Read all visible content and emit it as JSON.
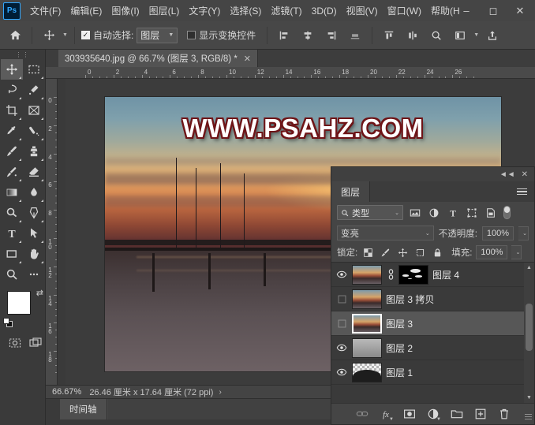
{
  "app": {
    "logo": "Ps",
    "menus": [
      {
        "label": "文件(F)"
      },
      {
        "label": "编辑(E)"
      },
      {
        "label": "图像(I)"
      },
      {
        "label": "图层(L)"
      },
      {
        "label": "文字(Y)"
      },
      {
        "label": "选择(S)"
      },
      {
        "label": "滤镜(T)"
      },
      {
        "label": "3D(D)"
      },
      {
        "label": "视图(V)"
      },
      {
        "label": "窗口(W)"
      },
      {
        "label": "帮助(H"
      }
    ],
    "window_controls": {
      "minimize": "–",
      "maximize": "◻",
      "close": "✕"
    }
  },
  "options_bar": {
    "home_icon": "home-icon",
    "tool_icon": "move-tool-icon",
    "auto_select_checked": true,
    "auto_select_label": "自动选择:",
    "auto_select_value": "图层",
    "show_transform_checked": false,
    "show_transform_label": "显示变换控件",
    "align_icons": [
      "align-left-icon",
      "align-center-horizontal-icon",
      "align-right-icon",
      "align-bottom-icon"
    ],
    "distribute_icons": [
      "distribute-top-icon",
      "distribute-vertical-center-icon"
    ],
    "search_icon": "search-icon",
    "workspace_icon": "workspace-icon",
    "share_icon": "share-icon"
  },
  "toolbar": {
    "grip": "⋮⋮",
    "tools": [
      {
        "name": "move-tool",
        "glyph": "✥",
        "active": true,
        "has_flyout": true
      },
      {
        "name": "marquee-tool",
        "glyph": "▭",
        "active": false,
        "has_flyout": true
      },
      {
        "name": "lasso-tool",
        "glyph": "◯",
        "active": false,
        "has_flyout": true
      },
      {
        "name": "quick-selection-tool",
        "glyph": "✎",
        "active": false,
        "has_flyout": true
      },
      {
        "name": "crop-tool",
        "glyph": "⌗",
        "active": false,
        "has_flyout": true
      },
      {
        "name": "frame-tool",
        "glyph": "⊠",
        "active": false,
        "has_flyout": true
      },
      {
        "name": "eyedropper-tool",
        "glyph": "✐",
        "active": false,
        "has_flyout": true
      },
      {
        "name": "healing-brush-tool",
        "glyph": "✦",
        "active": false,
        "has_flyout": true
      },
      {
        "name": "brush-tool",
        "glyph": "✏",
        "active": false,
        "has_flyout": true
      },
      {
        "name": "clone-stamp-tool",
        "glyph": "⎙",
        "active": false,
        "has_flyout": true
      },
      {
        "name": "history-brush-tool",
        "glyph": "✧",
        "active": false,
        "has_flyout": true
      },
      {
        "name": "eraser-tool",
        "glyph": "◣",
        "active": false,
        "has_flyout": true
      },
      {
        "name": "gradient-tool",
        "glyph": "▤",
        "active": false,
        "has_flyout": true
      },
      {
        "name": "blur-tool",
        "glyph": "◐",
        "active": false,
        "has_flyout": true
      },
      {
        "name": "dodge-tool",
        "glyph": "◔",
        "active": false,
        "has_flyout": true
      },
      {
        "name": "pen-tool",
        "glyph": "✒",
        "active": false,
        "has_flyout": true
      },
      {
        "name": "type-tool",
        "glyph": "T",
        "active": false,
        "has_flyout": true
      },
      {
        "name": "path-selection-tool",
        "glyph": "➤",
        "active": false,
        "has_flyout": true
      },
      {
        "name": "rectangle-tool",
        "glyph": "▭",
        "active": false,
        "has_flyout": true
      },
      {
        "name": "hand-tool",
        "glyph": "✋",
        "active": false,
        "has_flyout": true
      },
      {
        "name": "zoom-tool",
        "glyph": "⚲",
        "active": false,
        "has_flyout": false
      },
      {
        "name": "edit-toolbar-tool",
        "glyph": "•••",
        "active": false,
        "has_flyout": false
      }
    ],
    "foreground_color": "#ffffff",
    "background_color": "#8187a8",
    "swap_icon": "swap-colors-icon",
    "default_colors_icon": "default-colors-icon",
    "quick_mask_icon": "quick-mask-icon",
    "screen_mode_icon": "screen-mode-icon"
  },
  "document": {
    "tab_title": "303935640.jpg @ 66.7% (图层 3, RGB/8) *",
    "close_glyph": "✕",
    "watermark": "WWW.PSAHZ.COM",
    "ruler_h_ticks": [
      "0",
      "2",
      "4",
      "6",
      "8",
      "10",
      "12",
      "14",
      "16",
      "18",
      "20",
      "22",
      "24",
      "26"
    ],
    "ruler_v_ticks": [
      "0",
      "2",
      "4",
      "6",
      "8",
      "10",
      "12",
      "14",
      "16",
      "18"
    ]
  },
  "status_bar": {
    "zoom": "66.67%",
    "dimensions": "26.46 厘米 x 17.64 厘米 (72 ppi)",
    "arrow": "›"
  },
  "timeline": {
    "tab_label": "时间轴"
  },
  "layers_panel": {
    "collapse_icon": "collapse-panel-icon",
    "close_icon": "close-panel-icon",
    "tab_label": "图层",
    "menu_icon": "panel-menu-icon",
    "filter": {
      "search_icon": "search-icon",
      "type_label": "类型",
      "caret": "⌄",
      "icons": [
        {
          "name": "filter-pixel-icon",
          "glyph": "▣"
        },
        {
          "name": "filter-adjustment-icon",
          "glyph": "◑"
        },
        {
          "name": "filter-type-icon",
          "glyph": "T"
        },
        {
          "name": "filter-shape-icon",
          "glyph": "⬚"
        },
        {
          "name": "filter-smart-object-icon",
          "glyph": "▨"
        }
      ],
      "toggle_name": "filter-enable-toggle"
    },
    "blend_mode": "变亮",
    "opacity_label": "不透明度:",
    "opacity_value": "100%",
    "lock_label": "锁定:",
    "lock_icons": [
      {
        "name": "lock-transparency-icon",
        "glyph": "▦"
      },
      {
        "name": "lock-image-icon",
        "glyph": "✎"
      },
      {
        "name": "lock-position-icon",
        "glyph": "✥"
      },
      {
        "name": "lock-artboard-icon",
        "glyph": "⧉"
      },
      {
        "name": "lock-all-icon",
        "glyph": "🔒"
      }
    ],
    "fill_label": "填充:",
    "fill_value": "100%",
    "layers": [
      {
        "name": "图层 4",
        "visible": true,
        "selected": false,
        "thumb_type": "photo",
        "has_link": true,
        "has_mask": true
      },
      {
        "name": "图层 3 拷贝",
        "visible": false,
        "selected": false,
        "thumb_type": "photo",
        "has_link": false,
        "has_mask": false
      },
      {
        "name": "图层 3",
        "visible": false,
        "selected": true,
        "thumb_type": "photo",
        "has_link": false,
        "has_mask": false
      },
      {
        "name": "图层 2",
        "visible": true,
        "selected": false,
        "thumb_type": "gray",
        "has_link": false,
        "has_mask": false
      },
      {
        "name": "图层 1",
        "visible": true,
        "selected": false,
        "thumb_type": "checker",
        "has_link": false,
        "has_mask": false
      }
    ],
    "bottom_buttons": [
      {
        "name": "link-layers-button",
        "glyph": "⚭",
        "dim": true,
        "dropdown": false
      },
      {
        "name": "layer-style-button",
        "glyph": "fx",
        "dim": false,
        "dropdown": true
      },
      {
        "name": "add-layer-mask-button",
        "glyph": "◉",
        "dim": false,
        "dropdown": false
      },
      {
        "name": "new-adjustment-layer-button",
        "glyph": "◑",
        "dim": false,
        "dropdown": true
      },
      {
        "name": "new-group-button",
        "glyph": "▰",
        "dim": false,
        "dropdown": false
      },
      {
        "name": "new-layer-button",
        "glyph": "⊞",
        "dim": false,
        "dropdown": false
      },
      {
        "name": "delete-layer-button",
        "glyph": "🗑",
        "dim": false,
        "dropdown": false
      }
    ]
  }
}
